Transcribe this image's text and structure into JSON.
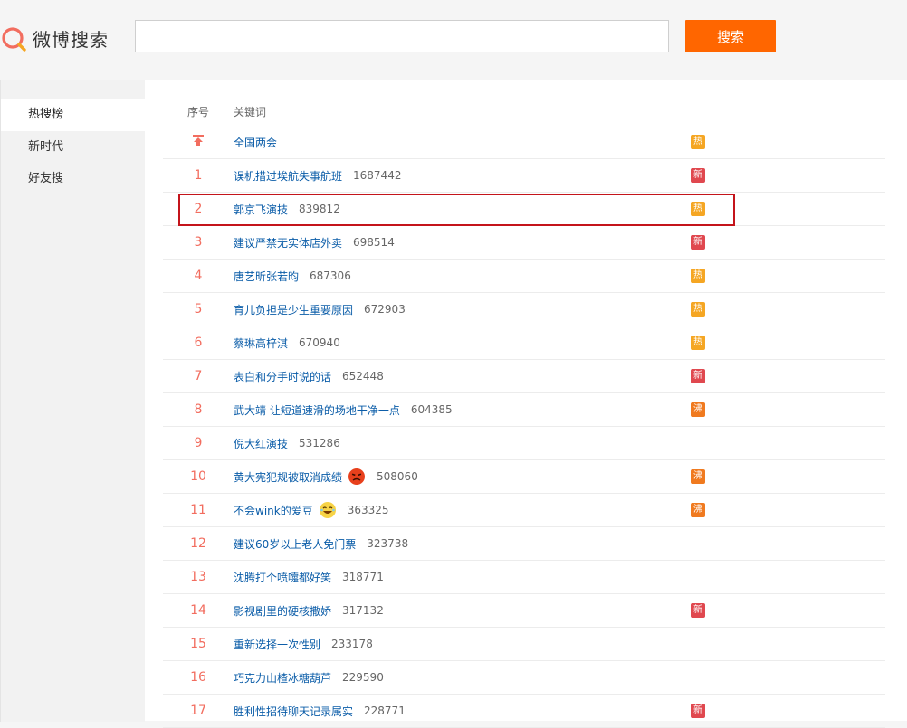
{
  "header": {
    "logo_text": "微博搜索",
    "search_value": "",
    "search_button": "搜索"
  },
  "sidebar": {
    "items": [
      {
        "label": "热搜榜",
        "active": true
      },
      {
        "label": "新时代",
        "active": false
      },
      {
        "label": "好友搜",
        "active": false
      }
    ]
  },
  "list": {
    "col_rank": "序号",
    "col_keyword": "关键词",
    "rows": [
      {
        "rank": "",
        "pinned": true,
        "keyword": "全国两会",
        "count": "",
        "tag": "热",
        "emoji": ""
      },
      {
        "rank": "1",
        "keyword": "误机措过埃航失事航班",
        "count": "1687442",
        "tag": "新",
        "emoji": ""
      },
      {
        "rank": "2",
        "keyword": "郭京飞演技",
        "count": "839812",
        "tag": "热",
        "emoji": ""
      },
      {
        "rank": "3",
        "keyword": "建议严禁无实体店外卖",
        "count": "698514",
        "tag": "新",
        "emoji": ""
      },
      {
        "rank": "4",
        "keyword": "唐艺昕张若昀",
        "count": "687306",
        "tag": "热",
        "emoji": ""
      },
      {
        "rank": "5",
        "keyword": "育儿负担是少生重要原因",
        "count": "672903",
        "tag": "热",
        "emoji": ""
      },
      {
        "rank": "6",
        "keyword": "蔡琳高梓淇",
        "count": "670940",
        "tag": "热",
        "emoji": ""
      },
      {
        "rank": "7",
        "keyword": "表白和分手时说的话",
        "count": "652448",
        "tag": "新",
        "emoji": ""
      },
      {
        "rank": "8",
        "keyword": "武大靖 让短道速滑的场地干净一点",
        "count": "604385",
        "tag": "沸",
        "emoji": ""
      },
      {
        "rank": "9",
        "keyword": "倪大红演技",
        "count": "531286",
        "tag": "",
        "emoji": ""
      },
      {
        "rank": "10",
        "keyword": "黄大宪犯规被取消成绩",
        "count": "508060",
        "tag": "沸",
        "emoji": "angry"
      },
      {
        "rank": "11",
        "keyword": "不会wink的爱豆",
        "count": "363325",
        "tag": "沸",
        "emoji": "laugh"
      },
      {
        "rank": "12",
        "keyword": "建议60岁以上老人免门票",
        "count": "323738",
        "tag": "",
        "emoji": ""
      },
      {
        "rank": "13",
        "keyword": "沈腾打个喷嚏都好笑",
        "count": "318771",
        "tag": "",
        "emoji": ""
      },
      {
        "rank": "14",
        "keyword": "影视剧里的硬核撒娇",
        "count": "317132",
        "tag": "新",
        "emoji": ""
      },
      {
        "rank": "15",
        "keyword": "重新选择一次性别",
        "count": "233178",
        "tag": "",
        "emoji": ""
      },
      {
        "rank": "16",
        "keyword": "巧克力山楂冰糖葫芦",
        "count": "229590",
        "tag": "",
        "emoji": ""
      },
      {
        "rank": "17",
        "keyword": "胜利性招待聊天记录属实",
        "count": "228771",
        "tag": "新",
        "emoji": ""
      }
    ]
  },
  "colors": {
    "accent": "#ff6600",
    "link": "#0a5ca8",
    "rank": "#f26d5f",
    "tag_hot": "#f5a623",
    "tag_new": "#e0484f",
    "tag_boil": "#f07a1f",
    "highlight_box": "#c4141b"
  }
}
